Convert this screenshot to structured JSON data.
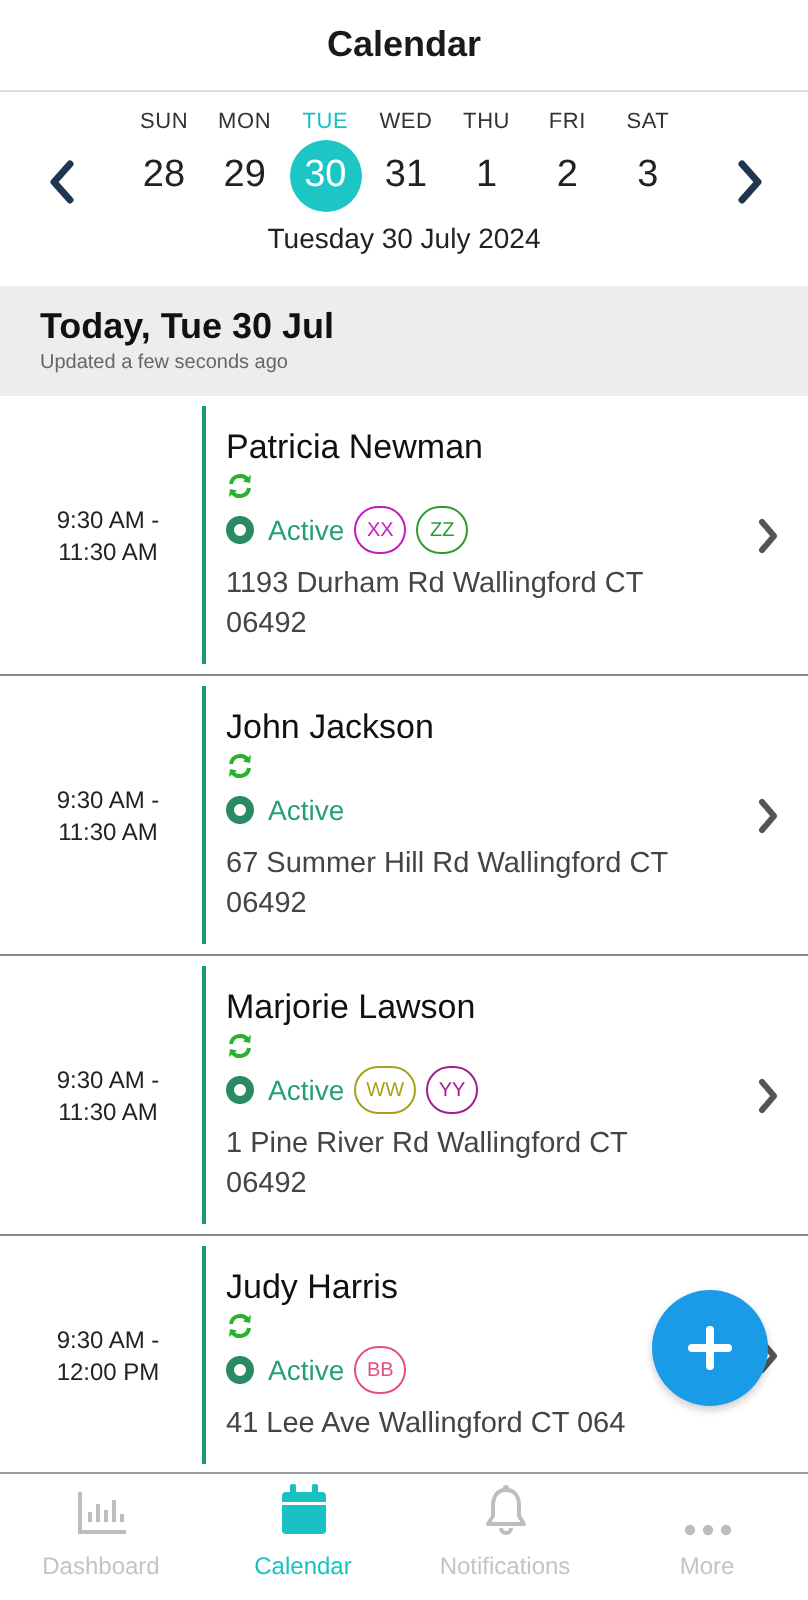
{
  "header": {
    "title": "Calendar"
  },
  "week": {
    "days": [
      {
        "weekday": "SUN",
        "date": "28",
        "selected": false
      },
      {
        "weekday": "MON",
        "date": "29",
        "selected": false
      },
      {
        "weekday": "TUE",
        "date": "30",
        "selected": true
      },
      {
        "weekday": "WED",
        "date": "31",
        "selected": false
      },
      {
        "weekday": "THU",
        "date": "1",
        "selected": false
      },
      {
        "weekday": "FRI",
        "date": "2",
        "selected": false
      },
      {
        "weekday": "SAT",
        "date": "3",
        "selected": false
      }
    ],
    "full_date": "Tuesday 30 July 2024"
  },
  "day_banner": {
    "title": "Today, Tue 30 Jul",
    "subtitle": "Updated a few seconds ago"
  },
  "appointments": [
    {
      "time_start": "9:30 AM -",
      "time_end": "11:30 AM",
      "name": "Patricia Newman",
      "status": "Active",
      "tags": [
        {
          "label": "XX",
          "color": "#c21dc2"
        },
        {
          "label": "ZZ",
          "color": "#2f9a34"
        }
      ],
      "address": "1193 Durham Rd Wallingford CT 06492"
    },
    {
      "time_start": "9:30 AM -",
      "time_end": "11:30 AM",
      "name": "John Jackson",
      "status": "Active",
      "address": "67 Summer Hill Rd Wallingford CT 06492"
    },
    {
      "time_start": "9:30 AM -",
      "time_end": "11:30 AM",
      "name": "Marjorie Lawson",
      "status": "Active",
      "tags": [
        {
          "label": "WW",
          "color": "#a3a31a"
        },
        {
          "label": "YY",
          "color": "#a0208f"
        }
      ],
      "address": "1 Pine River Rd Wallingford CT 06492"
    },
    {
      "time_start": "9:30 AM -",
      "time_end": "12:00 PM",
      "name": "Judy Harris",
      "status": "Active",
      "tags": [
        {
          "label": "BB",
          "color": "#e2507e"
        }
      ],
      "address": "41 Lee Ave Wallingford CT 064"
    }
  ],
  "tab_bar": [
    {
      "label": "Dashboard",
      "selected": false
    },
    {
      "label": "Calendar",
      "selected": true
    },
    {
      "label": "Notifications",
      "selected": false
    },
    {
      "label": "More",
      "selected": false
    }
  ]
}
